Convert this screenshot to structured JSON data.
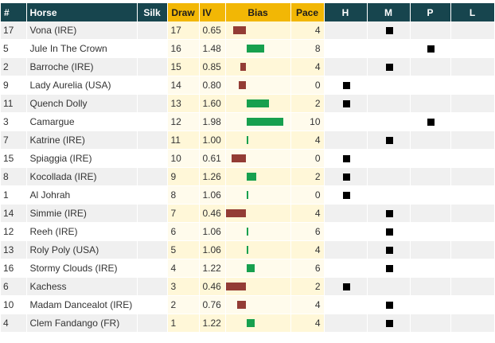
{
  "headers": {
    "num": "#",
    "horse": "Horse",
    "silk": "Silk",
    "draw": "Draw",
    "iv": "IV",
    "bias": "Bias",
    "pace": "Pace",
    "h": "H",
    "m": "M",
    "p": "P",
    "l": "L"
  },
  "colors": {
    "header": "#17454e",
    "highlight_header": "#f2b705",
    "bias_positive": "#17a04e",
    "bias_negative": "#933c35"
  },
  "rows": [
    {
      "num": "17",
      "horse": "Vona (IRE)",
      "draw": "17",
      "iv": "0.65",
      "pace": "4",
      "style": "M"
    },
    {
      "num": "5",
      "horse": "Jule In The Crown",
      "draw": "16",
      "iv": "1.48",
      "pace": "8",
      "style": "P"
    },
    {
      "num": "2",
      "horse": "Barroche (IRE)",
      "draw": "15",
      "iv": "0.85",
      "pace": "4",
      "style": "M"
    },
    {
      "num": "9",
      "horse": "Lady Aurelia (USA)",
      "draw": "14",
      "iv": "0.80",
      "pace": "0",
      "style": "H"
    },
    {
      "num": "11",
      "horse": "Quench Dolly",
      "draw": "13",
      "iv": "1.60",
      "pace": "2",
      "style": "H"
    },
    {
      "num": "3",
      "horse": "Camargue",
      "draw": "12",
      "iv": "1.98",
      "pace": "10",
      "style": "P"
    },
    {
      "num": "7",
      "horse": "Katrine (IRE)",
      "draw": "11",
      "iv": "1.00",
      "pace": "4",
      "style": "M"
    },
    {
      "num": "15",
      "horse": "Spiaggia (IRE)",
      "draw": "10",
      "iv": "0.61",
      "pace": "0",
      "style": "H"
    },
    {
      "num": "8",
      "horse": "Kocollada (IRE)",
      "draw": "9",
      "iv": "1.26",
      "pace": "2",
      "style": "H"
    },
    {
      "num": "1",
      "horse": "Al Johrah",
      "draw": "8",
      "iv": "1.06",
      "pace": "0",
      "style": "H"
    },
    {
      "num": "14",
      "horse": "Simmie (IRE)",
      "draw": "7",
      "iv": "0.46",
      "pace": "4",
      "style": "M"
    },
    {
      "num": "12",
      "horse": "Reeh (IRE)",
      "draw": "6",
      "iv": "1.06",
      "pace": "6",
      "style": "M"
    },
    {
      "num": "13",
      "horse": "Roly Poly (USA)",
      "draw": "5",
      "iv": "1.06",
      "pace": "4",
      "style": "M"
    },
    {
      "num": "16",
      "horse": "Stormy Clouds (IRE)",
      "draw": "4",
      "iv": "1.22",
      "pace": "6",
      "style": "M"
    },
    {
      "num": "6",
      "horse": "Kachess",
      "draw": "3",
      "iv": "0.46",
      "pace": "2",
      "style": "H"
    },
    {
      "num": "10",
      "horse": "Madam Dancealot (IRE)",
      "draw": "2",
      "iv": "0.76",
      "pace": "4",
      "style": "M"
    },
    {
      "num": "4",
      "horse": "Clem Fandango (FR)",
      "draw": "1",
      "iv": "1.22",
      "pace": "4",
      "style": "M"
    }
  ]
}
